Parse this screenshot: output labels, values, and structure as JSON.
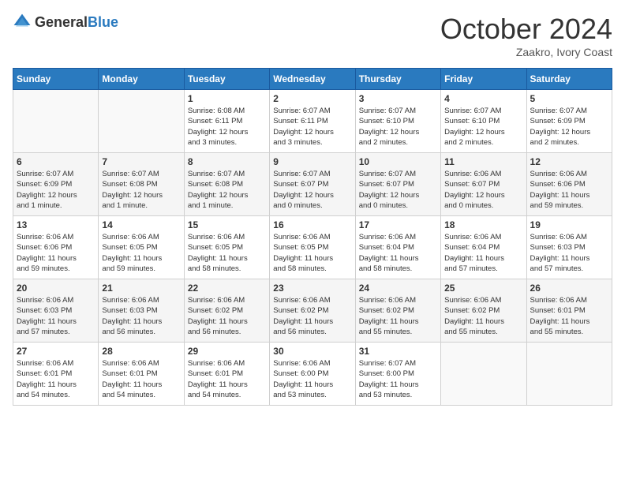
{
  "header": {
    "logo_general": "General",
    "logo_blue": "Blue",
    "month_title": "October 2024",
    "subtitle": "Zaakro, Ivory Coast"
  },
  "days_of_week": [
    "Sunday",
    "Monday",
    "Tuesday",
    "Wednesday",
    "Thursday",
    "Friday",
    "Saturday"
  ],
  "weeks": [
    [
      {
        "day": "",
        "info": ""
      },
      {
        "day": "",
        "info": ""
      },
      {
        "day": "1",
        "info": "Sunrise: 6:08 AM\nSunset: 6:11 PM\nDaylight: 12 hours\nand 3 minutes."
      },
      {
        "day": "2",
        "info": "Sunrise: 6:07 AM\nSunset: 6:11 PM\nDaylight: 12 hours\nand 3 minutes."
      },
      {
        "day": "3",
        "info": "Sunrise: 6:07 AM\nSunset: 6:10 PM\nDaylight: 12 hours\nand 2 minutes."
      },
      {
        "day": "4",
        "info": "Sunrise: 6:07 AM\nSunset: 6:10 PM\nDaylight: 12 hours\nand 2 minutes."
      },
      {
        "day": "5",
        "info": "Sunrise: 6:07 AM\nSunset: 6:09 PM\nDaylight: 12 hours\nand 2 minutes."
      }
    ],
    [
      {
        "day": "6",
        "info": "Sunrise: 6:07 AM\nSunset: 6:09 PM\nDaylight: 12 hours\nand 1 minute."
      },
      {
        "day": "7",
        "info": "Sunrise: 6:07 AM\nSunset: 6:08 PM\nDaylight: 12 hours\nand 1 minute."
      },
      {
        "day": "8",
        "info": "Sunrise: 6:07 AM\nSunset: 6:08 PM\nDaylight: 12 hours\nand 1 minute."
      },
      {
        "day": "9",
        "info": "Sunrise: 6:07 AM\nSunset: 6:07 PM\nDaylight: 12 hours\nand 0 minutes."
      },
      {
        "day": "10",
        "info": "Sunrise: 6:07 AM\nSunset: 6:07 PM\nDaylight: 12 hours\nand 0 minutes."
      },
      {
        "day": "11",
        "info": "Sunrise: 6:06 AM\nSunset: 6:07 PM\nDaylight: 12 hours\nand 0 minutes."
      },
      {
        "day": "12",
        "info": "Sunrise: 6:06 AM\nSunset: 6:06 PM\nDaylight: 11 hours\nand 59 minutes."
      }
    ],
    [
      {
        "day": "13",
        "info": "Sunrise: 6:06 AM\nSunset: 6:06 PM\nDaylight: 11 hours\nand 59 minutes."
      },
      {
        "day": "14",
        "info": "Sunrise: 6:06 AM\nSunset: 6:05 PM\nDaylight: 11 hours\nand 59 minutes."
      },
      {
        "day": "15",
        "info": "Sunrise: 6:06 AM\nSunset: 6:05 PM\nDaylight: 11 hours\nand 58 minutes."
      },
      {
        "day": "16",
        "info": "Sunrise: 6:06 AM\nSunset: 6:05 PM\nDaylight: 11 hours\nand 58 minutes."
      },
      {
        "day": "17",
        "info": "Sunrise: 6:06 AM\nSunset: 6:04 PM\nDaylight: 11 hours\nand 58 minutes."
      },
      {
        "day": "18",
        "info": "Sunrise: 6:06 AM\nSunset: 6:04 PM\nDaylight: 11 hours\nand 57 minutes."
      },
      {
        "day": "19",
        "info": "Sunrise: 6:06 AM\nSunset: 6:03 PM\nDaylight: 11 hours\nand 57 minutes."
      }
    ],
    [
      {
        "day": "20",
        "info": "Sunrise: 6:06 AM\nSunset: 6:03 PM\nDaylight: 11 hours\nand 57 minutes."
      },
      {
        "day": "21",
        "info": "Sunrise: 6:06 AM\nSunset: 6:03 PM\nDaylight: 11 hours\nand 56 minutes."
      },
      {
        "day": "22",
        "info": "Sunrise: 6:06 AM\nSunset: 6:02 PM\nDaylight: 11 hours\nand 56 minutes."
      },
      {
        "day": "23",
        "info": "Sunrise: 6:06 AM\nSunset: 6:02 PM\nDaylight: 11 hours\nand 56 minutes."
      },
      {
        "day": "24",
        "info": "Sunrise: 6:06 AM\nSunset: 6:02 PM\nDaylight: 11 hours\nand 55 minutes."
      },
      {
        "day": "25",
        "info": "Sunrise: 6:06 AM\nSunset: 6:02 PM\nDaylight: 11 hours\nand 55 minutes."
      },
      {
        "day": "26",
        "info": "Sunrise: 6:06 AM\nSunset: 6:01 PM\nDaylight: 11 hours\nand 55 minutes."
      }
    ],
    [
      {
        "day": "27",
        "info": "Sunrise: 6:06 AM\nSunset: 6:01 PM\nDaylight: 11 hours\nand 54 minutes."
      },
      {
        "day": "28",
        "info": "Sunrise: 6:06 AM\nSunset: 6:01 PM\nDaylight: 11 hours\nand 54 minutes."
      },
      {
        "day": "29",
        "info": "Sunrise: 6:06 AM\nSunset: 6:01 PM\nDaylight: 11 hours\nand 54 minutes."
      },
      {
        "day": "30",
        "info": "Sunrise: 6:06 AM\nSunset: 6:00 PM\nDaylight: 11 hours\nand 53 minutes."
      },
      {
        "day": "31",
        "info": "Sunrise: 6:07 AM\nSunset: 6:00 PM\nDaylight: 11 hours\nand 53 minutes."
      },
      {
        "day": "",
        "info": ""
      },
      {
        "day": "",
        "info": ""
      }
    ]
  ]
}
